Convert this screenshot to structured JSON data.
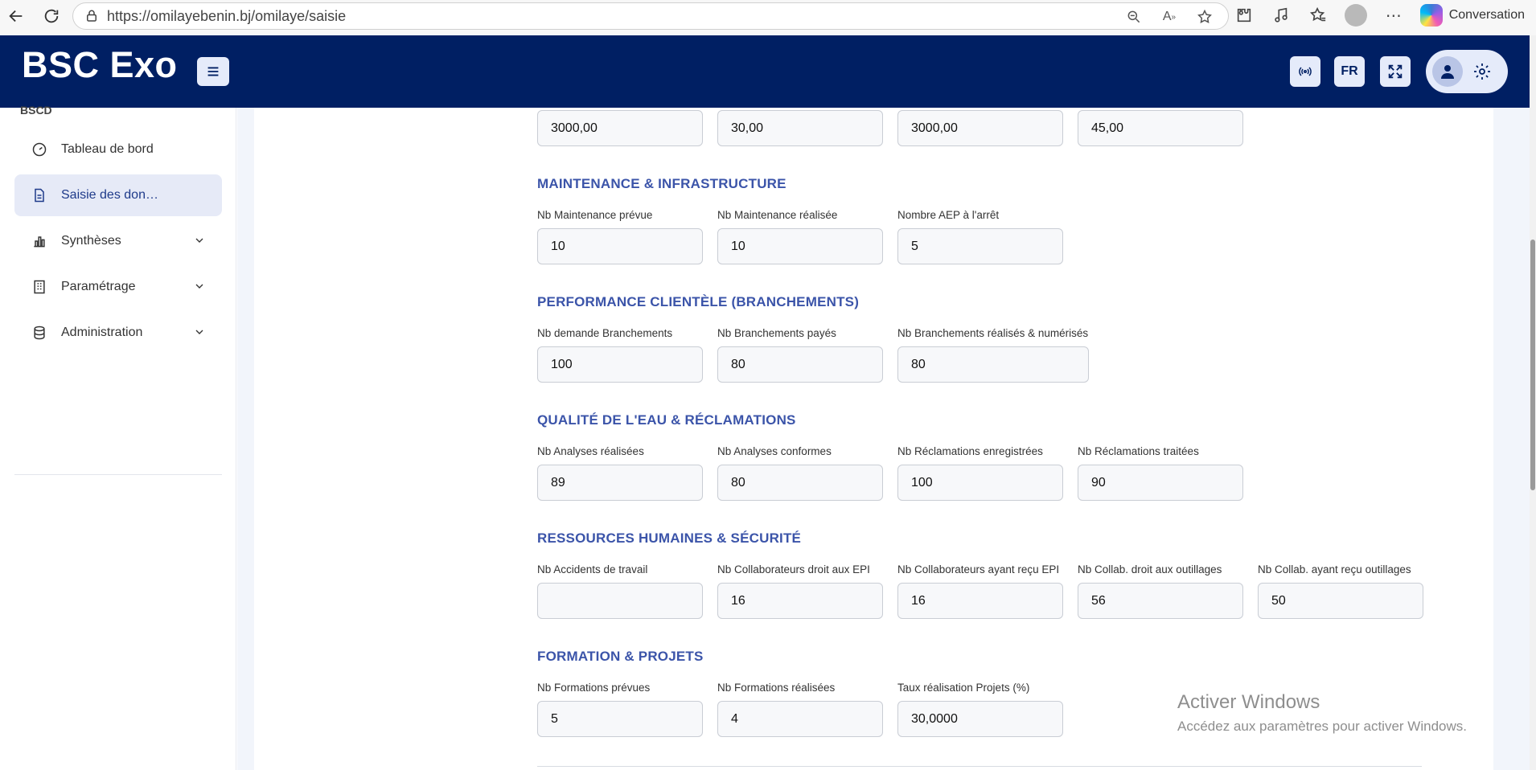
{
  "browser": {
    "url": "https://omilayebenin.bj/omilaye/saisie",
    "conversation_label": "Conversation"
  },
  "header": {
    "logo": "BSC Exo",
    "lang": "FR"
  },
  "sidebar": {
    "section": "BSCD",
    "items": [
      {
        "label": "Tableau de bord",
        "icon": "gauge-icon"
      },
      {
        "label": "Saisie des don…",
        "icon": "document-icon"
      },
      {
        "label": "Synthèses",
        "icon": "bar-chart-icon"
      },
      {
        "label": "Paramétrage",
        "icon": "building-icon"
      },
      {
        "label": "Administration",
        "icon": "database-icon"
      }
    ]
  },
  "top_row": [
    "3000,00",
    "30,00",
    "3000,00",
    "45,00"
  ],
  "sections": {
    "maintenance": {
      "title": "MAINTENANCE & INFRASTRUCTURE",
      "fields": [
        {
          "label": "Nb Maintenance prévue",
          "value": "10"
        },
        {
          "label": "Nb Maintenance réalisée",
          "value": "10"
        },
        {
          "label": "Nombre AEP à l'arrêt",
          "value": "5"
        }
      ]
    },
    "client": {
      "title": "PERFORMANCE CLIENTÈLE (BRANCHEMENTS)",
      "fields": [
        {
          "label": "Nb demande Branchements",
          "value": "100"
        },
        {
          "label": "Nb Branchements payés",
          "value": "80"
        },
        {
          "label": "Nb Branchements réalisés & numérisés",
          "value": "80"
        }
      ]
    },
    "water": {
      "title": "QUALITÉ DE L'EAU & RÉCLAMATIONS",
      "fields": [
        {
          "label": "Nb Analyses réalisées",
          "value": "89"
        },
        {
          "label": "Nb Analyses conformes",
          "value": "80"
        },
        {
          "label": "Nb Réclamations enregistrées",
          "value": "100"
        },
        {
          "label": "Nb Réclamations traitées",
          "value": "90"
        }
      ]
    },
    "hr": {
      "title": "RESSOURCES HUMAINES & SÉCURITÉ",
      "fields": [
        {
          "label": "Nb Accidents de travail",
          "value": ""
        },
        {
          "label": "Nb Collaborateurs droit aux EPI",
          "value": "16"
        },
        {
          "label": "Nb Collaborateurs ayant reçu EPI",
          "value": "16"
        },
        {
          "label": "Nb Collab. droit aux outillages",
          "value": "56"
        },
        {
          "label": "Nb Collab. ayant reçu outillages",
          "value": "50"
        }
      ]
    },
    "training": {
      "title": "FORMATION & PROJETS",
      "fields": [
        {
          "label": "Nb Formations prévues",
          "value": "5"
        },
        {
          "label": "Nb Formations réalisées",
          "value": "4"
        },
        {
          "label": "Taux réalisation Projets (%)",
          "value": "30,0000"
        }
      ]
    }
  },
  "watermark": {
    "line1": "Activer Windows",
    "line2": "Accédez aux paramètres pour activer Windows."
  }
}
